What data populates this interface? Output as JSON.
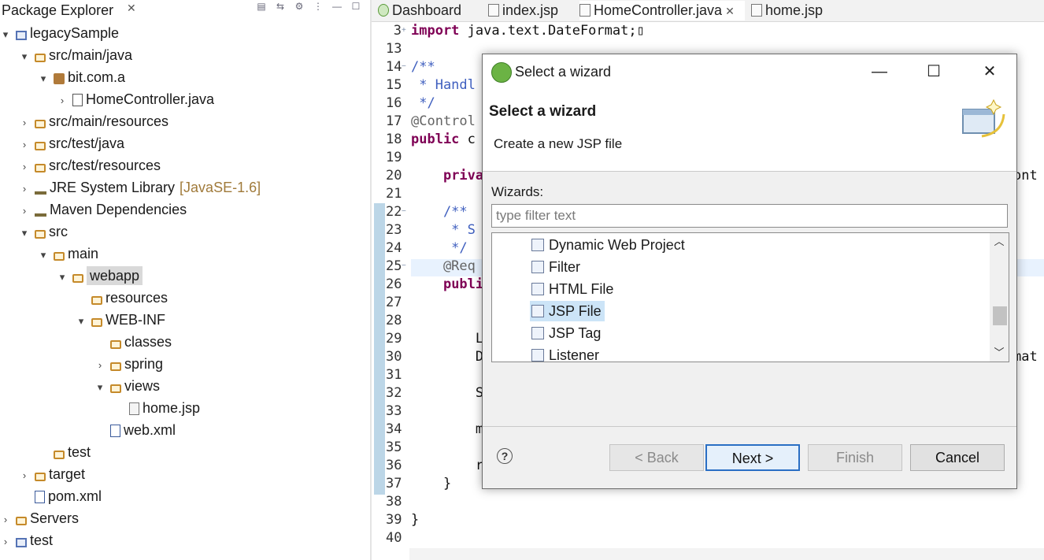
{
  "package_explorer": {
    "title": "Package Explorer",
    "close_glyph": "✕",
    "tree": [
      {
        "label": "legacySample",
        "chev": "▾",
        "icon": "proj",
        "indent": 0
      },
      {
        "label": "src/main/java",
        "chev": "▾",
        "icon": "folder",
        "indent": 1
      },
      {
        "label": "bit.com.a",
        "chev": "▾",
        "icon": "pkg",
        "indent": 2
      },
      {
        "label": "HomeController.java",
        "chev": "›",
        "icon": "java",
        "indent": 3
      },
      {
        "label": "src/main/resources",
        "chev": "›",
        "icon": "folder",
        "indent": 1
      },
      {
        "label": "src/test/java",
        "chev": "›",
        "icon": "folder",
        "indent": 1
      },
      {
        "label": "src/test/resources",
        "chev": "›",
        "icon": "folder",
        "indent": 1
      },
      {
        "label": "JRE System Library",
        "deco": "[JavaSE-1.6]",
        "chev": "›",
        "icon": "lib",
        "indent": 1
      },
      {
        "label": "Maven Dependencies",
        "chev": "›",
        "icon": "lib",
        "indent": 1
      },
      {
        "label": "src",
        "chev": "▾",
        "icon": "folder",
        "indent": 1
      },
      {
        "label": "main",
        "chev": "▾",
        "icon": "folder",
        "indent": 2
      },
      {
        "label": "webapp",
        "chev": "▾",
        "icon": "folder",
        "indent": 3,
        "selected": true
      },
      {
        "label": "resources",
        "chev": "",
        "icon": "folder",
        "indent": 4
      },
      {
        "label": "WEB-INF",
        "chev": "▾",
        "icon": "folder",
        "indent": 4
      },
      {
        "label": "classes",
        "chev": "",
        "icon": "folder",
        "indent": 5
      },
      {
        "label": "spring",
        "chev": "›",
        "icon": "folder",
        "indent": 5
      },
      {
        "label": "views",
        "chev": "▾",
        "icon": "folder",
        "indent": 5
      },
      {
        "label": "home.jsp",
        "chev": "",
        "icon": "jsp",
        "indent": 6
      },
      {
        "label": "web.xml",
        "chev": "",
        "icon": "xml",
        "indent": 5
      },
      {
        "label": "test",
        "chev": "",
        "icon": "folder",
        "indent": 2
      },
      {
        "label": "target",
        "chev": "›",
        "icon": "folder",
        "indent": 1
      },
      {
        "label": "pom.xml",
        "chev": "",
        "icon": "xml",
        "indent": 1
      },
      {
        "label": "Servers",
        "chev": "›",
        "icon": "folder",
        "indent": 0
      },
      {
        "label": "test",
        "chev": "›",
        "icon": "proj",
        "indent": 0
      }
    ]
  },
  "editor": {
    "tabs": [
      {
        "label": "Dashboard",
        "icon": "dash",
        "active": false
      },
      {
        "label": "index.jsp",
        "icon": "file",
        "active": false
      },
      {
        "label": "HomeController.java",
        "icon": "file",
        "active": true,
        "close": "✕"
      },
      {
        "label": "home.jsp",
        "icon": "file",
        "active": false
      }
    ],
    "lines": [
      {
        "n": "3",
        "fold": "+",
        "parts": [
          [
            "kw",
            "import"
          ],
          [
            "",
            "java.text.DateFormat;▯"
          ]
        ]
      },
      {
        "n": "13",
        "parts": []
      },
      {
        "n": "14",
        "fold": "−",
        "parts": [
          [
            "cm",
            "/**"
          ]
        ]
      },
      {
        "n": "15",
        "parts": [
          [
            "cm",
            " * Handl"
          ]
        ]
      },
      {
        "n": "16",
        "parts": [
          [
            "cm",
            " */"
          ]
        ]
      },
      {
        "n": "17",
        "parts": [
          [
            "an",
            "@Control"
          ]
        ]
      },
      {
        "n": "18",
        "parts": [
          [
            "kw",
            "public"
          ],
          [
            "",
            " c"
          ]
        ]
      },
      {
        "n": "19",
        "parts": []
      },
      {
        "n": "20",
        "parts": [
          [
            "",
            "    "
          ],
          [
            "kw",
            "priva"
          ]
        ],
        "tail": "ont"
      },
      {
        "n": "21",
        "parts": []
      },
      {
        "n": "22",
        "fold": "−",
        "parts": [
          [
            "cm",
            "    /**"
          ]
        ]
      },
      {
        "n": "23",
        "parts": [
          [
            "cm",
            "     * S"
          ]
        ]
      },
      {
        "n": "24",
        "parts": [
          [
            "cm",
            "     */"
          ]
        ]
      },
      {
        "n": "25",
        "fold": "−",
        "parts": [
          [
            "an",
            "    @Req"
          ]
        ],
        "highlight": true
      },
      {
        "n": "26",
        "parts": [
          [
            "",
            "    "
          ],
          [
            "kw",
            "publi"
          ]
        ]
      },
      {
        "n": "27",
        "parts": []
      },
      {
        "n": "28",
        "parts": []
      },
      {
        "n": "29",
        "parts": [
          [
            "",
            "        L"
          ]
        ]
      },
      {
        "n": "30",
        "parts": [
          [
            "",
            "        D"
          ]
        ],
        "tail": "mat"
      },
      {
        "n": "31",
        "parts": []
      },
      {
        "n": "32",
        "parts": [
          [
            "",
            "        S"
          ]
        ]
      },
      {
        "n": "33",
        "parts": []
      },
      {
        "n": "34",
        "parts": [
          [
            "",
            "        m"
          ]
        ]
      },
      {
        "n": "35",
        "parts": []
      },
      {
        "n": "36",
        "parts": [
          [
            "",
            "        r"
          ]
        ]
      },
      {
        "n": "37",
        "parts": [
          [
            "",
            "    }"
          ]
        ]
      },
      {
        "n": "38",
        "parts": []
      },
      {
        "n": "39",
        "parts": [
          [
            "",
            "}"
          ]
        ]
      },
      {
        "n": "40",
        "parts": []
      }
    ]
  },
  "dialog": {
    "title": "Select a wizard",
    "minimize": "—",
    "maximize": "☐",
    "close": "✕",
    "heading": "Select a wizard",
    "description": "Create a new JSP file",
    "wizards_label": "Wizards:",
    "filter_placeholder": "type filter text",
    "filter_value": "",
    "items": [
      {
        "label": "Dynamic Web Project",
        "selected": false
      },
      {
        "label": "Filter",
        "selected": false
      },
      {
        "label": "HTML File",
        "selected": false
      },
      {
        "label": "JSP File",
        "selected": true
      },
      {
        "label": "JSP Tag",
        "selected": false
      },
      {
        "label": "Listener",
        "selected": false
      }
    ],
    "scroll_up": "︿",
    "scroll_down": "﹀",
    "help": "?",
    "buttons": {
      "back": "< Back",
      "next": "Next >",
      "finish": "Finish",
      "cancel": "Cancel"
    }
  }
}
